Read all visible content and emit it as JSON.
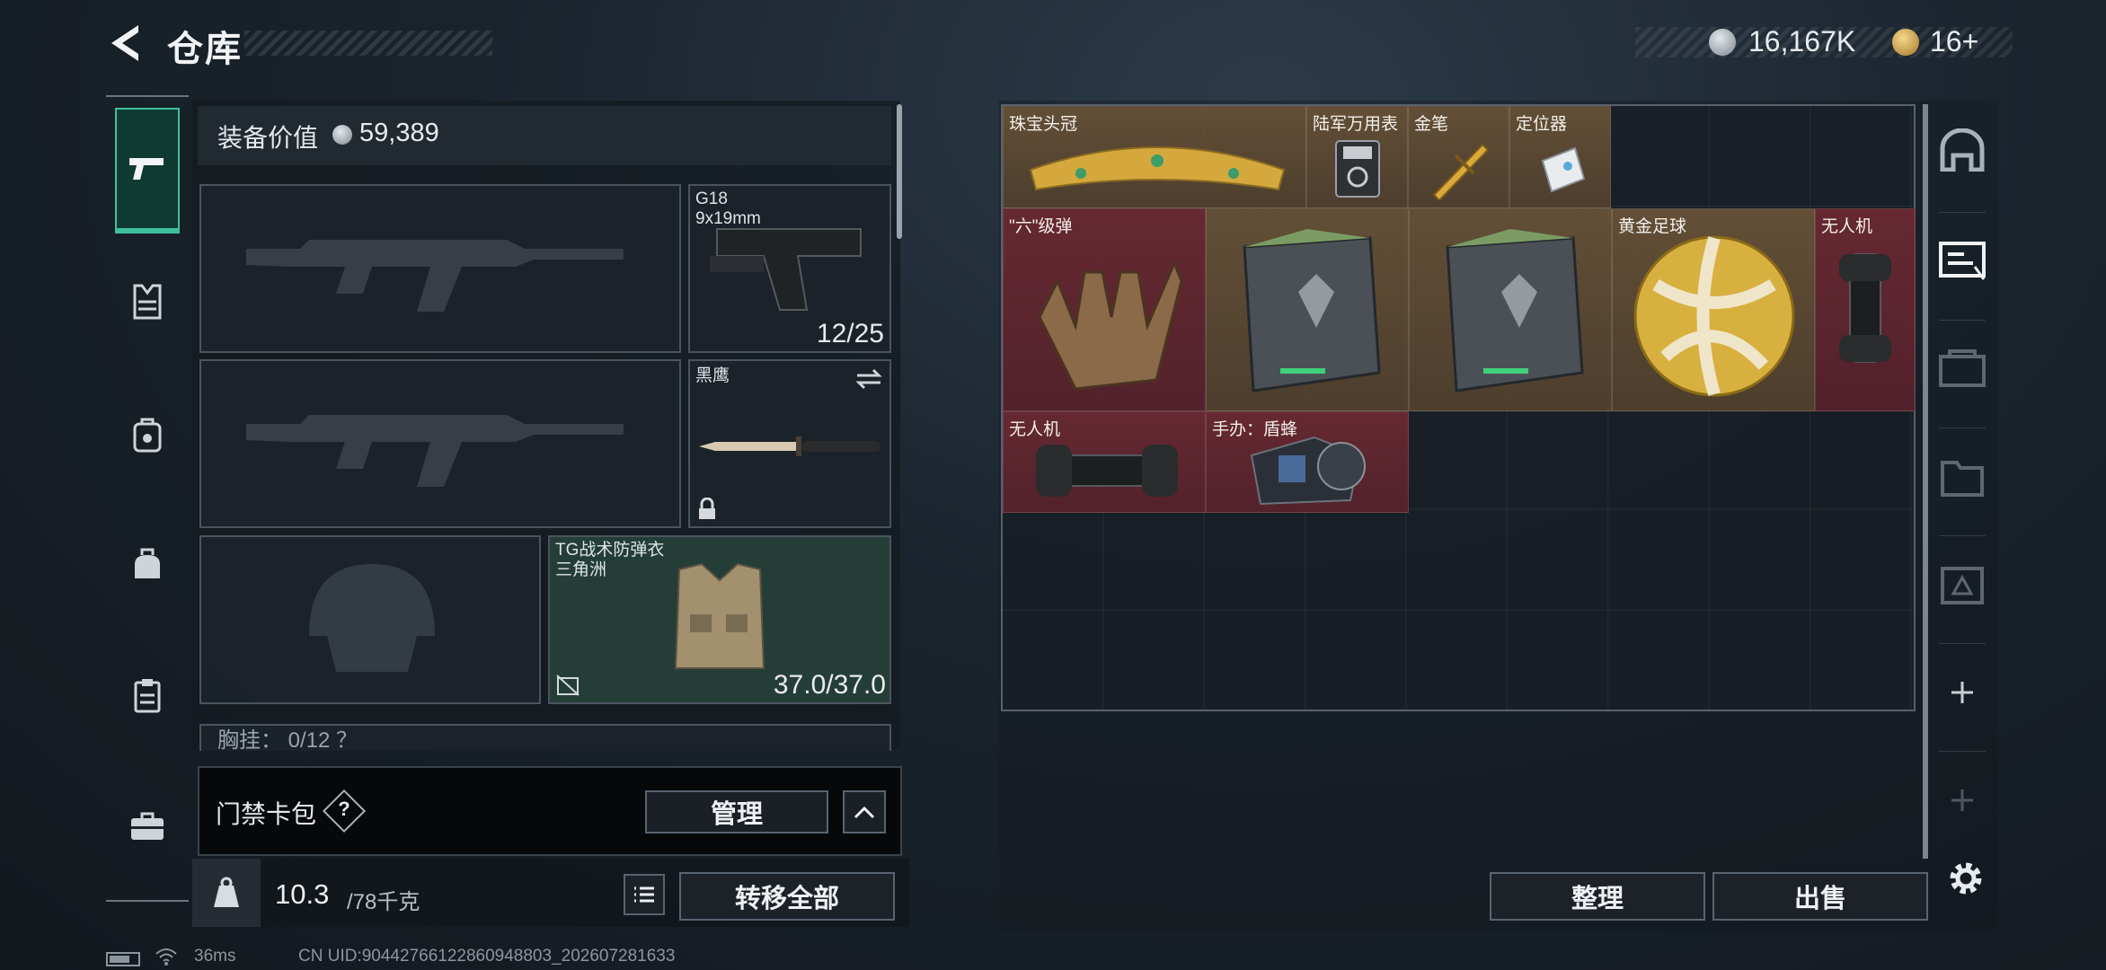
{
  "header": {
    "title": "仓库",
    "currency_1": "16,167K",
    "currency_2": "16+"
  },
  "equipment": {
    "value_label": "装备价值",
    "value": "59,389",
    "pistol": {
      "name": "G18",
      "caliber": "9x19mm",
      "ammo": "12/25"
    },
    "melee": {
      "name": "黑鹰"
    },
    "armor": {
      "name": "TG战术防弹衣",
      "sub": "三角洲",
      "durability": "37.0/37.0"
    },
    "chest_rig_label": "胸挂：  0/12  ？"
  },
  "keycard": {
    "label": "门禁卡包",
    "help": "?",
    "manage_button": "管理"
  },
  "weight": {
    "current": "10.3",
    "capacity": "/78千克",
    "kg_icon_text": "KG",
    "transfer_all_button": "转移全部"
  },
  "stash": {
    "items": [
      {
        "name": "珠宝头冠",
        "rarity": "gold"
      },
      {
        "name": "陆军万用表",
        "rarity": "gold"
      },
      {
        "name": "金笔",
        "rarity": "gold"
      },
      {
        "name": "定位器",
        "rarity": "gold"
      },
      {
        "name": "\"六\"级弹",
        "rarity": "red"
      },
      {
        "name": "",
        "rarity": "gold"
      },
      {
        "name": "",
        "rarity": "gold"
      },
      {
        "name": "黄金足球",
        "rarity": "gold"
      },
      {
        "name": "无人机",
        "rarity": "red"
      },
      {
        "name": "无人机",
        "rarity": "red"
      },
      {
        "name": "手办：盾蜂",
        "rarity": "red"
      }
    ],
    "sort_button": "整理",
    "sell_button": "出售"
  },
  "status_bar": {
    "ping": "36ms",
    "uid": "CN UID:90442766122860948803_202607281633"
  },
  "colors": {
    "accent": "#3fc09c",
    "gold_rarity": "#7a5c3a",
    "red_rarity": "#732a34"
  },
  "icons": {
    "sidebar": [
      "pistol-icon",
      "armor-icon",
      "backpack-icon",
      "helmet-bag-icon",
      "clipboard-icon",
      "briefcase-icon"
    ],
    "right_sidebar": [
      "safe-icon",
      "card-icon",
      "gear-case-icon",
      "folder-icon",
      "kit-icon",
      "plus-icon",
      "plus-icon",
      "settings-icon"
    ]
  }
}
